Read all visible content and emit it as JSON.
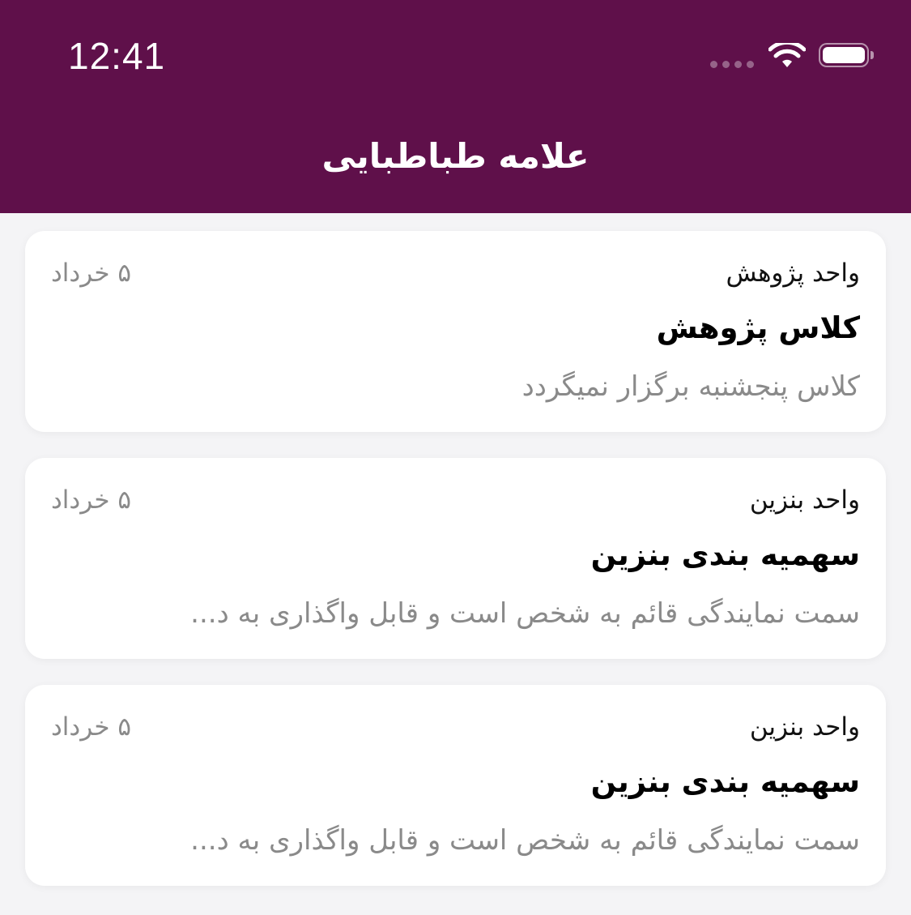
{
  "status_bar": {
    "time": "12:41"
  },
  "header": {
    "title": "علامه طباطبایی",
    "background": "#5f104a"
  },
  "cards": [
    {
      "category": "واحد پژوهش",
      "date": "۵ خرداد",
      "title": "کلاس پژوهش",
      "body": "کلاس پنجشنبه برگزار نمیگردد"
    },
    {
      "category": "واحد بنزین",
      "date": "۵ خرداد",
      "title": "سهمیه بندی بنزین",
      "body": "سمت نمایندگی قائم به شخص است و قابل واگذاری به د..."
    },
    {
      "category": "واحد بنزین",
      "date": "۵ خرداد",
      "title": "سهمیه بندی بنزین",
      "body": "سمت نمایندگی قائم به شخص است و قابل واگذاری به د..."
    }
  ]
}
